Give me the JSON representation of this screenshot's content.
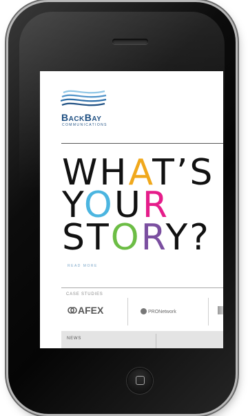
{
  "brand": {
    "name": "BackBay",
    "tagline": "COMMUNICATIONS"
  },
  "hero": {
    "line1": [
      {
        "text": "WH",
        "color": "#111111"
      },
      {
        "text": "A",
        "color": "#f0a81c"
      },
      {
        "text": "T’S",
        "color": "#111111"
      }
    ],
    "line2": [
      {
        "text": "Y",
        "color": "#111111"
      },
      {
        "text": "O",
        "color": "#4bb5e0"
      },
      {
        "text": "U",
        "color": "#111111"
      },
      {
        "text": "R",
        "color": "#e51d8a"
      }
    ],
    "line3": [
      {
        "text": "ST",
        "color": "#111111"
      },
      {
        "text": "O",
        "color": "#6cbd45"
      },
      {
        "text": "R",
        "color": "#7b4fa0"
      },
      {
        "text": "Y?",
        "color": "#111111"
      }
    ],
    "read_more": "READ MORE"
  },
  "case_studies": {
    "label": "CASE STUDIES",
    "logos": [
      "AFEX",
      "PRONetwork"
    ]
  },
  "news": {
    "label": "NEWS"
  },
  "colors": {
    "brand_blue": "#1e4f82",
    "wave_light": "#8fc6e6"
  },
  "icons": {
    "home_button": "home-square-icon"
  }
}
